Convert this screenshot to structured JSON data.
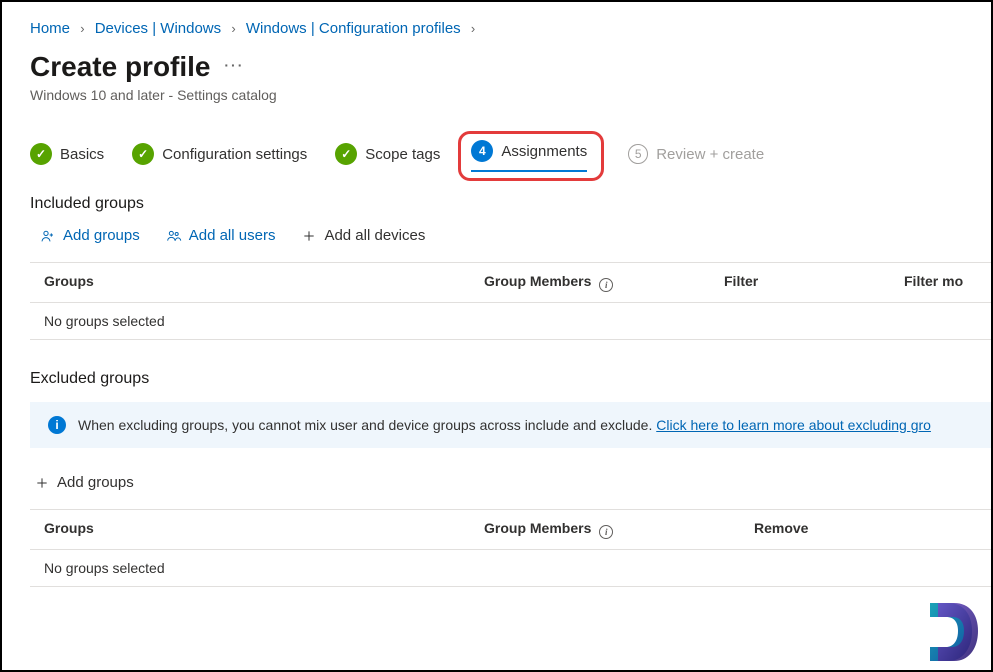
{
  "breadcrumb": {
    "items": [
      "Home",
      "Devices | Windows",
      "Windows | Configuration profiles"
    ]
  },
  "header": {
    "title": "Create profile",
    "subtitle": "Windows 10 and later - Settings catalog"
  },
  "steps": {
    "basics": "Basics",
    "config": "Configuration settings",
    "scope": "Scope tags",
    "assign_num": "4",
    "assign": "Assignments",
    "review_num": "5",
    "review": "Review + create"
  },
  "included": {
    "title": "Included groups",
    "actions": {
      "add_groups": "Add groups",
      "add_users": "Add all users",
      "add_devices": "Add all devices"
    },
    "headers": {
      "groups": "Groups",
      "members": "Group Members",
      "filter": "Filter",
      "filter_mode": "Filter mo"
    },
    "empty": "No groups selected"
  },
  "excluded": {
    "title": "Excluded groups",
    "banner_text": "When excluding groups, you cannot mix user and device groups across include and exclude. ",
    "banner_link": "Click here to learn more about excluding gro",
    "action_add": "Add groups",
    "headers": {
      "groups": "Groups",
      "members": "Group Members",
      "remove": "Remove"
    },
    "empty": "No groups selected"
  }
}
